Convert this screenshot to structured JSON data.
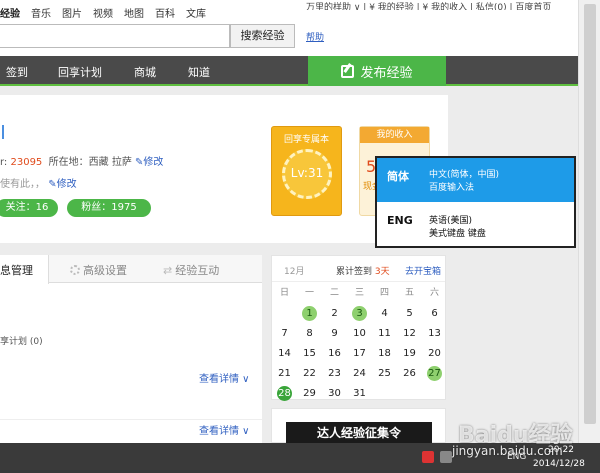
{
  "topnav": {
    "links": [
      "经验",
      "音乐",
      "图片",
      "视频",
      "地图",
      "百科",
      "文库"
    ],
    "user": "万里的样助 ∨  |  ¥ 我的经验  |  ¥ 我的收入  |  私信(0)  |  百度首页"
  },
  "search": {
    "button": "搜索经验",
    "help": "帮助"
  },
  "mainnav": {
    "items": [
      "签到",
      "回享计划",
      "商城",
      "知道"
    ],
    "publish": "发布经验"
  },
  "profile": {
    "exp_prefix": "r: ",
    "exp_value": "23095",
    "location": "所在地：西藏 拉萨",
    "edit": "修改",
    "signature": "使有此，，",
    "edit2": "修改",
    "follow": "关注：16",
    "fans": "粉丝：1975"
  },
  "badge": {
    "title": "回享专属本",
    "level": "Lv:31"
  },
  "income": {
    "title": "我的收入",
    "value": "5",
    "sub": "现金"
  },
  "ime": {
    "options": [
      {
        "code": "简体",
        "lang": "中文(简体，中国)",
        "layout": "百度输入法",
        "selected": true
      },
      {
        "code": "ENG",
        "lang": "英语(美国)",
        "layout": "美式键盘 键盘",
        "selected": false
      }
    ]
  },
  "tabs": {
    "items": [
      "息管理",
      "高级设置",
      "经验互动"
    ],
    "plan": "享计划 (0)",
    "detail1": "查看详情 ∨",
    "detail2": "查看详情 ∨"
  },
  "calendar": {
    "month": "12月",
    "checkin_label": "累计签到",
    "checkin_days": "3天",
    "open_box": "去开宝箱",
    "weekdays": [
      "日",
      "一",
      "二",
      "三",
      "四",
      "五",
      "六"
    ],
    "weeks": [
      [
        "",
        "1",
        "2",
        "3",
        "4",
        "5",
        "6"
      ],
      [
        "7",
        "8",
        "9",
        "10",
        "11",
        "12",
        "13"
      ],
      [
        "14",
        "15",
        "16",
        "17",
        "18",
        "19",
        "20"
      ],
      [
        "21",
        "22",
        "23",
        "24",
        "25",
        "26",
        "27"
      ],
      [
        "28",
        "29",
        "30",
        "31",
        "",
        "",
        ""
      ]
    ],
    "signed_days": [
      "1",
      "3",
      "27"
    ],
    "today": "28"
  },
  "banner": {
    "text": "达人经验征集令"
  },
  "taskbar": {
    "lang": "ENG",
    "time": "20:22",
    "date": "2014/12/28"
  },
  "watermark": {
    "text": "Baidu经验",
    "url": "jingyan.baidu.com"
  }
}
